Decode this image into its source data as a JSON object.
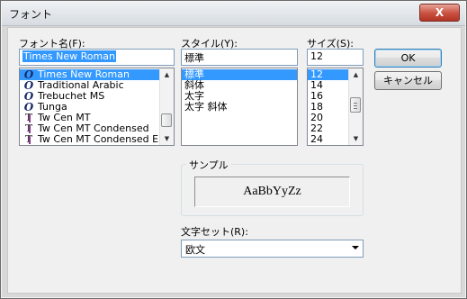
{
  "window": {
    "title": "フォント",
    "close_label": "X"
  },
  "font": {
    "label": "フォント名(F):",
    "value": "Times New Roman",
    "items": [
      {
        "name": "Times New Roman",
        "icon": "opentype-icon",
        "selected": true
      },
      {
        "name": "Traditional Arabic",
        "icon": "opentype-icon",
        "selected": false
      },
      {
        "name": "Trebuchet MS",
        "icon": "opentype-icon",
        "selected": false
      },
      {
        "name": "Tunga",
        "icon": "opentype-icon",
        "selected": false
      },
      {
        "name": "Tw Cen MT",
        "icon": "truetype-icon",
        "selected": false
      },
      {
        "name": "Tw Cen MT Condensed",
        "icon": "truetype-icon",
        "selected": false
      },
      {
        "name": "Tw Cen MT Condensed E:",
        "icon": "truetype-icon",
        "selected": false
      }
    ]
  },
  "style": {
    "label": "スタイル(Y):",
    "value": "標準",
    "items": [
      {
        "name": "標準",
        "selected": true
      },
      {
        "name": "斜体",
        "selected": false
      },
      {
        "name": "太字",
        "selected": false
      },
      {
        "name": "太字 斜体",
        "selected": false
      }
    ]
  },
  "size": {
    "label": "サイズ(S):",
    "value": "12",
    "items": [
      {
        "name": "12",
        "selected": true
      },
      {
        "name": "14",
        "selected": false
      },
      {
        "name": "16",
        "selected": false
      },
      {
        "name": "18",
        "selected": false
      },
      {
        "name": "20",
        "selected": false
      },
      {
        "name": "22",
        "selected": false
      },
      {
        "name": "24",
        "selected": false
      }
    ]
  },
  "buttons": {
    "ok": "OK",
    "cancel": "キャンセル"
  },
  "sample": {
    "caption": "サンプル",
    "text": "AaBbYyZz"
  },
  "charset": {
    "label": "文字セット(R):",
    "value": "欧文"
  },
  "colors": {
    "selection": "#3399ff",
    "dialog_bg": "#f0f0f0",
    "close_button": "#c9503f"
  }
}
